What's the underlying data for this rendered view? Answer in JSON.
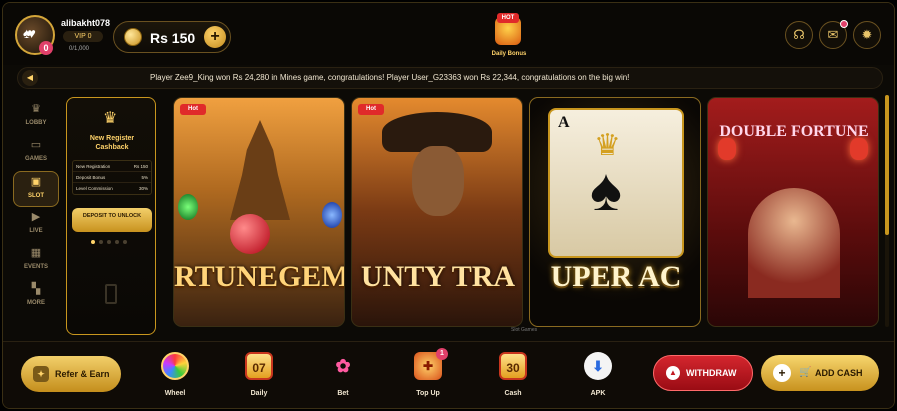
{
  "header": {
    "username": "alibakht078",
    "vip_label": "VIP 0",
    "vip_progress": "0/1,000",
    "avatar_badge": "0",
    "balance": "Rs 150",
    "add_symbol": "+",
    "daily_bonus_hot": "HOT",
    "daily_bonus_label": "Daily Bonus",
    "icons": [
      "headset-icon",
      "mail-icon",
      "gear-icon"
    ]
  },
  "ticker": {
    "text": "Player Zee9_King won Rs 24,280 in Mines game, congratulations! Player User_G23363 won Rs 22,344, congratulations on the big win!"
  },
  "sidebar": {
    "items": [
      {
        "label": "LOBBY",
        "icon": "crown-icon"
      },
      {
        "label": "GAMES",
        "icon": "gamepad-icon"
      },
      {
        "label": "SLOT",
        "icon": "slot-icon",
        "active": true
      },
      {
        "label": "LIVE",
        "icon": "play-icon"
      },
      {
        "label": "EVENTS",
        "icon": "calendar-icon"
      },
      {
        "label": "MORE",
        "icon": "grid-icon"
      }
    ]
  },
  "promo": {
    "title": "New Register Cashback",
    "rows": [
      {
        "label": "New Registration",
        "value": "Rs 150"
      },
      {
        "label": "Deposit Bonus",
        "value": "5%"
      },
      {
        "label": "Level Commission",
        "value": "30%"
      }
    ],
    "button": "DEPOSIT TO UNLOCK",
    "dots": 5,
    "active_dot": 0
  },
  "games": [
    {
      "title": "RTUNEGEM",
      "hot": "Hot"
    },
    {
      "title": "UNTY TRA",
      "hot": "Hot"
    },
    {
      "title": "UPER AC",
      "card_letter": "A"
    },
    {
      "title": "DOUBLE FORTUNE"
    }
  ],
  "slot_caption": "Slot Games",
  "bottom": {
    "refer": "Refer & Earn",
    "tools": [
      {
        "label": "Wheel",
        "icon": "wheel-icon"
      },
      {
        "label": "Daily",
        "icon": "calendar-icon",
        "value": "07"
      },
      {
        "label": "Bet",
        "icon": "bet-icon"
      },
      {
        "label": "Top Up",
        "icon": "gift-icon",
        "badge": "1"
      },
      {
        "label": "Cash",
        "icon": "calendar-icon",
        "value": "30"
      },
      {
        "label": "APK",
        "icon": "download-icon"
      }
    ],
    "withdraw": "WITHDRAW",
    "add_cash": "ADD CASH"
  }
}
